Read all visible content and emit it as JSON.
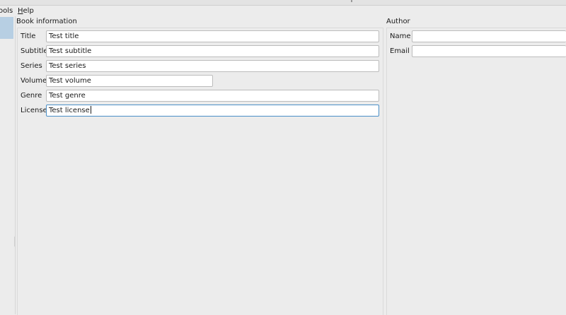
{
  "menubar": {
    "tools_label": "ools",
    "help_label": "Help",
    "help_mnemonic": "H",
    "help_rest": "elp"
  },
  "book_info": {
    "title": "Book information",
    "fields": [
      {
        "label": "Title",
        "value": "Test title"
      },
      {
        "label": "Subtitle",
        "value": "Test subtitle"
      },
      {
        "label": "Series",
        "value": "Test series"
      },
      {
        "label": "Volume",
        "value": "Test volume"
      },
      {
        "label": "Genre",
        "value": "Test genre"
      },
      {
        "label": "License",
        "value": "Test license"
      }
    ]
  },
  "author": {
    "title": "Author",
    "fields": [
      {
        "label": "Name",
        "value": ""
      },
      {
        "label": "Email",
        "value": ""
      }
    ]
  },
  "colors": {
    "focus_border": "#4a8fc7",
    "selected_tab": "#b7cfe3"
  }
}
